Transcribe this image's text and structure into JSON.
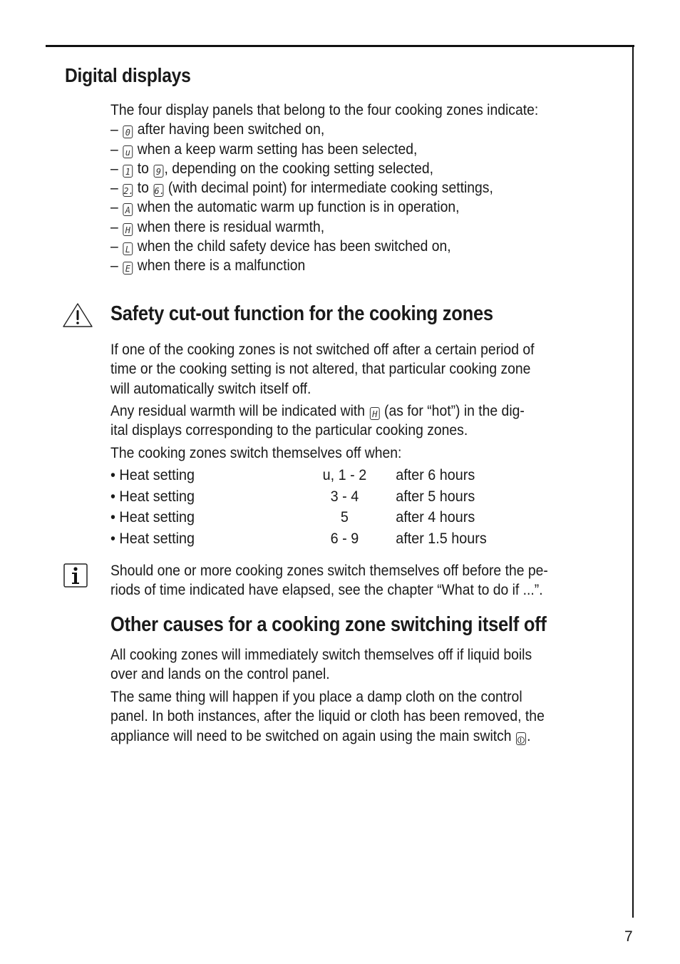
{
  "page": {
    "number": "7"
  },
  "digital_displays": {
    "heading": "Digital displays",
    "intro": "The four display panels that belong to the four cooking zones indicate:",
    "items": [
      {
        "dash": "–",
        "symbols": [
          "0"
        ],
        "text": " after having been switched on,"
      },
      {
        "dash": "–",
        "symbols": [
          "u"
        ],
        "text": " when a keep warm setting has been selected,"
      },
      {
        "dash": "–",
        "symbols": [
          "1",
          "9"
        ],
        "connector": " to ",
        "text": ", depending on the cooking setting selected,"
      },
      {
        "dash": "–",
        "symbols": [
          "2.",
          "6."
        ],
        "connector": " to ",
        "text": " (with decimal point) for intermediate cooking settings,"
      },
      {
        "dash": "–",
        "symbols": [
          "A"
        ],
        "text": " when the automatic warm up function is in operation,"
      },
      {
        "dash": "–",
        "symbols": [
          "H"
        ],
        "text": " when there is residual warmth,"
      },
      {
        "dash": "–",
        "symbols": [
          "L"
        ],
        "text": " when the child safety device has been switched on,"
      },
      {
        "dash": "–",
        "symbols": [
          "E"
        ],
        "text": " when there is a malfunction"
      }
    ]
  },
  "safety_cutout": {
    "icon": "warning-triangle-icon",
    "heading": "Safety cut-out function for the cooking zones",
    "para1": [
      "If one of the cooking zones is not switched off after a certain period of",
      "time or the cooking setting is not altered, that particular cooking zone",
      "will automatically switch itself off."
    ],
    "para2_before_symbol": "Any residual warmth will be indicated with ",
    "para2_symbol": "H",
    "para2_after_symbol": " (as for “hot”) in the dig-",
    "para2_line2": "ital displays corresponding to the particular cooking zones.",
    "para3": "The cooking zones switch themselves off when:",
    "settings": [
      {
        "label": "• Heat setting",
        "level": "u, 1 - 2",
        "duration": "after 6 hours"
      },
      {
        "label": "• Heat setting",
        "level": "3 - 4",
        "duration": "after 5 hours"
      },
      {
        "label": "• Heat setting",
        "level": "5",
        "duration": "after 4 hours"
      },
      {
        "label": "• Heat setting",
        "level": "6 - 9",
        "duration": "after 1.5 hours"
      }
    ]
  },
  "info_note": {
    "icon": "info-icon",
    "lines": [
      "Should one or more cooking zones switch themselves off before the pe-",
      "riods of time indicated have elapsed, see the chapter “What to do if ...”."
    ]
  },
  "other_causes": {
    "heading": "Other causes for a cooking zone switching itself off",
    "para1": [
      "All cooking zones will immediately switch themselves off if liquid boils",
      "over and lands on the control panel."
    ],
    "para2": [
      "The same thing will happen if you place a damp cloth on the control",
      "panel. In both instances, after the liquid or cloth has been removed, the"
    ],
    "para2_last_before_symbol": "appliance will need to be switched on again using the main switch ",
    "para2_last_symbol": "power-switch-icon",
    "para2_last_after_symbol": "."
  }
}
